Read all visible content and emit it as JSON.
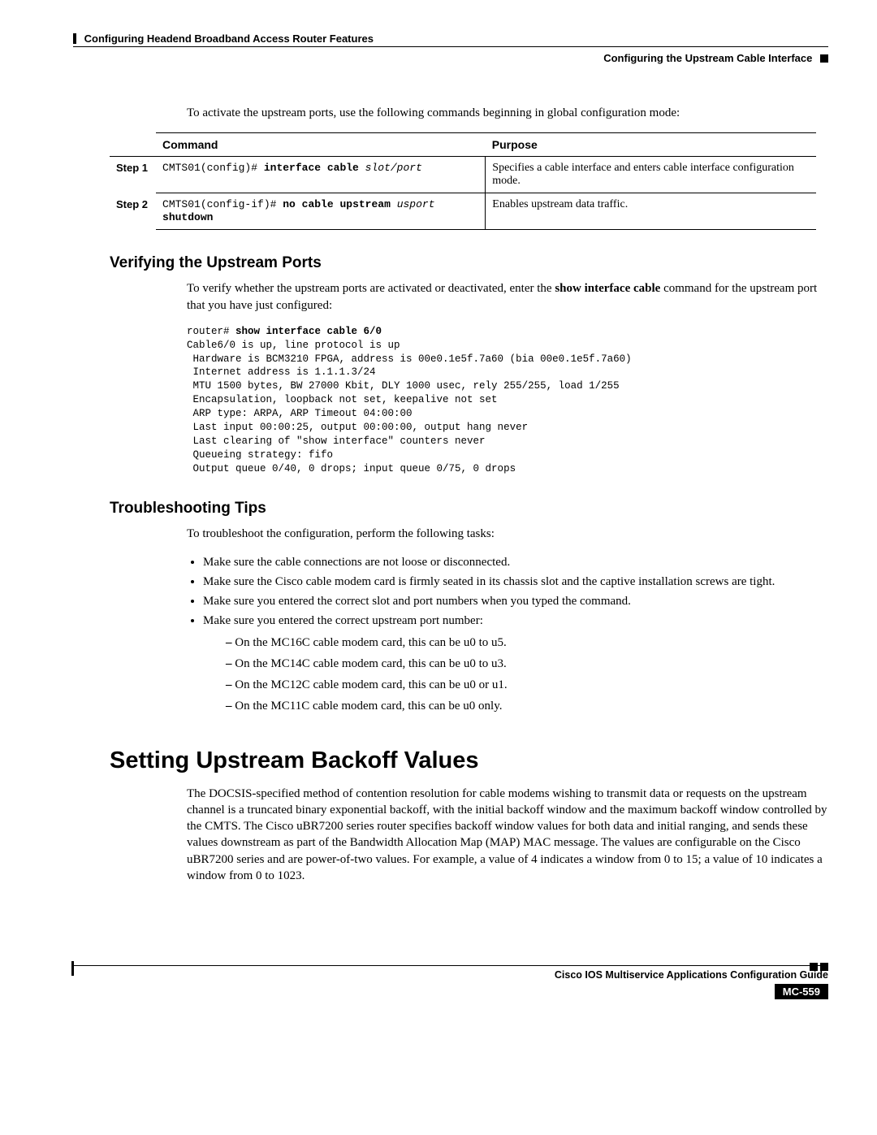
{
  "header": {
    "chapter": "Configuring Headend Broadband Access Router Features",
    "sub": "Configuring the Upstream Cable Interface"
  },
  "intro": "To activate the upstream ports, use the following commands beginning in global configuration mode:",
  "table": {
    "head_command": "Command",
    "head_purpose": "Purpose",
    "step1_label": "Step 1",
    "step2_label": "Step 2",
    "step1_prompt": "CMTS01(config)# ",
    "step1_cmd_bold": "interface cable ",
    "step1_cmd_italic": "slot/port",
    "step1_purpose": "Specifies a cable interface and enters cable interface configuration mode.",
    "step2_prompt": "CMTS01(config-if)# ",
    "step2_cmd_bold1": "no cable upstream ",
    "step2_cmd_italic": "usport ",
    "step2_cmd_bold2": "shutdown",
    "step2_purpose": "Enables upstream data traffic."
  },
  "verify": {
    "title": "Verifying the Upstream Ports",
    "text_pre": "To verify whether the upstream ports are activated or deactivated, enter the ",
    "text_bold": "show interface cable",
    "text_post": " command for the upstream port that you have just configured:",
    "code_prompt": "router# ",
    "code_cmd": "show interface cable 6/0",
    "code_lines": [
      "Cable6/0 is up, line protocol is up",
      " Hardware is BCM3210 FPGA, address is 00e0.1e5f.7a60 (bia 00e0.1e5f.7a60)",
      " Internet address is 1.1.1.3/24",
      " MTU 1500 bytes, BW 27000 Kbit, DLY 1000 usec, rely 255/255, load 1/255",
      " Encapsulation, loopback not set, keepalive not set",
      " ARP type: ARPA, ARP Timeout 04:00:00",
      " Last input 00:00:25, output 00:00:00, output hang never",
      " Last clearing of \"show interface\" counters never",
      " Queueing strategy: fifo",
      " Output queue 0/40, 0 drops; input queue 0/75, 0 drops"
    ]
  },
  "trouble": {
    "title": "Troubleshooting Tips",
    "text": "To troubleshoot the configuration, perform the following tasks:",
    "b1": "Make sure the cable connections are not loose or disconnected.",
    "b2": "Make sure the Cisco cable modem card is firmly seated in its chassis slot and the captive installation screws are tight.",
    "b3": "Make sure you entered the correct slot and port numbers when you typed the command.",
    "b4": "Make sure you entered the correct upstream port number:",
    "s1": "On the MC16C cable modem card, this can be u0 to u5.",
    "s2": "On the MC14C cable modem card, this can be u0 to u3.",
    "s3": "On the MC12C cable modem card, this can be u0 or u1.",
    "s4": "On the MC11C cable modem card, this can be u0 only."
  },
  "backoff": {
    "title": "Setting Upstream Backoff Values",
    "text": "The DOCSIS-specified method of contention resolution for cable modems wishing to transmit data or requests on the upstream channel is a truncated binary exponential backoff, with the initial backoff window and the maximum backoff window controlled by the CMTS. The Cisco uBR7200 series router specifies backoff window values for both data and initial ranging, and sends these values downstream as part of the Bandwidth Allocation Map (MAP) MAC message. The values are configurable on the Cisco uBR7200 series and are power-of-two values.  For example, a value of 4 indicates a window from 0 to 15; a value of 10 indicates a window from 0 to 1023."
  },
  "footer": {
    "guide": "Cisco IOS Multiservice Applications Configuration Guide",
    "page": "MC-559"
  }
}
